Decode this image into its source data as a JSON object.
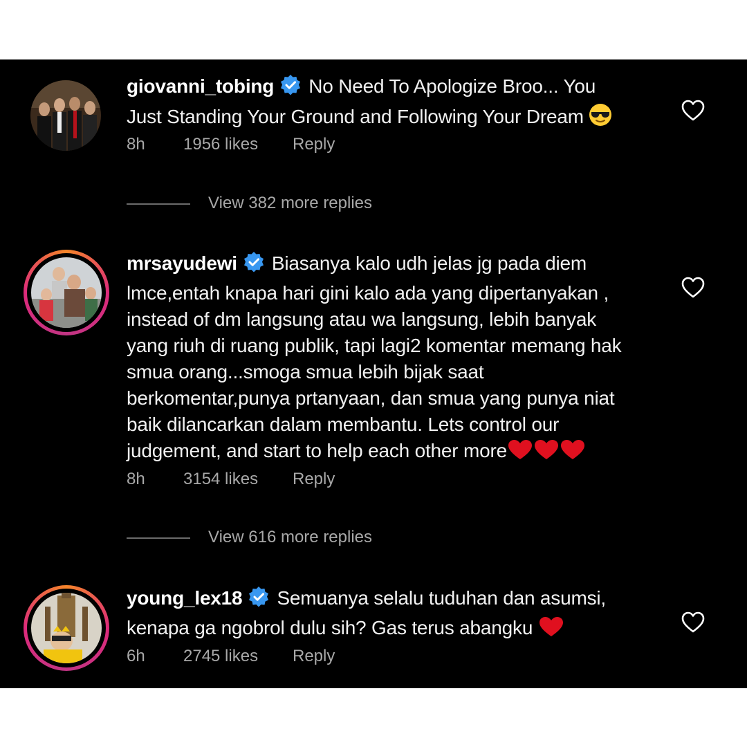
{
  "comments": [
    {
      "username": "giovanni_tobing",
      "text": "No Need To Apologize Broo... You Just Standing Your Ground and Following Your Dream",
      "emoji": "sunglasses-emoji",
      "time": "8h",
      "likes": "1956 likes",
      "reply": "Reply",
      "view_replies": "View 382 more replies"
    },
    {
      "username": "mrsayudewi",
      "text": "Biasanya kalo udh jelas jg pada diem lmce,entah knapa hari gini kalo ada yang dipertanyakan , instead of dm langsung atau wa langsung, lebih banyak yang riuh di ruang publik, tapi lagi2 komentar memang hak smua orang...smoga smua lebih bijak saat berkomentar,punya prtanyaan, dan smua yang punya niat baik dilancarkan dalam membantu. Lets control our judgement, and start to help each other more",
      "emoji": "red-heart-emoji x3",
      "time": "8h",
      "likes": "3154 likes",
      "reply": "Reply",
      "view_replies": "View 616 more replies"
    },
    {
      "username": "young_lex18",
      "text": "Semuanya selalu tuduhan dan asumsi, kenapa ga ngobrol dulu sih? Gas terus abangku",
      "emoji": "red-heart-emoji",
      "time": "6h",
      "likes": "2745 likes",
      "reply": "Reply"
    }
  ],
  "colors": {
    "background": "#000000",
    "text": "#f1f1f1",
    "muted": "#a8a8a8",
    "verified": "#3897f0",
    "heart": "#e0101f"
  }
}
